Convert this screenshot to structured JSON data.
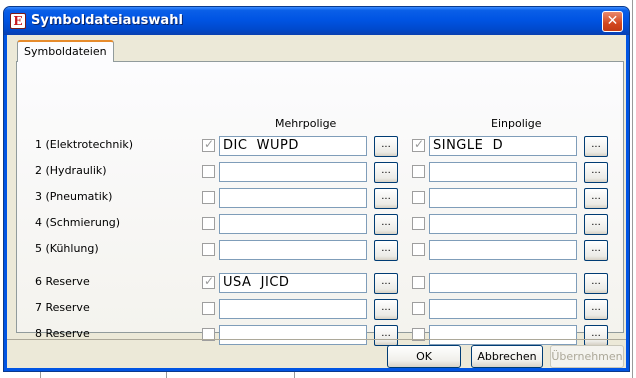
{
  "window": {
    "title": "Symboldateiauswahl",
    "close_glyph": "✕"
  },
  "tab": {
    "label": "Symboldateien"
  },
  "columns": {
    "multi": "Mehrpolige",
    "single": "Einpolige"
  },
  "rows": [
    {
      "label": "1 (Elektrotechnik)",
      "multi_checked": true,
      "multi_value": "DIC  WUPD",
      "single_checked": true,
      "single_value": "SINGLE  D"
    },
    {
      "label": "2 (Hydraulik)",
      "multi_checked": false,
      "multi_value": "",
      "single_checked": false,
      "single_value": ""
    },
    {
      "label": "3 (Pneumatik)",
      "multi_checked": false,
      "multi_value": "",
      "single_checked": false,
      "single_value": ""
    },
    {
      "label": "4 (Schmierung)",
      "multi_checked": false,
      "multi_value": "",
      "single_checked": false,
      "single_value": ""
    },
    {
      "label": "5 (Kühlung)",
      "multi_checked": false,
      "multi_value": "",
      "single_checked": false,
      "single_value": ""
    },
    {
      "label": "6 Reserve",
      "multi_checked": true,
      "multi_value": "USA  JICD",
      "single_checked": false,
      "single_value": ""
    },
    {
      "label": "7 Reserve",
      "multi_checked": false,
      "multi_value": "",
      "single_checked": false,
      "single_value": ""
    },
    {
      "label": "8 Reserve",
      "multi_checked": false,
      "multi_value": "",
      "single_checked": false,
      "single_value": ""
    }
  ],
  "browse_label": "...",
  "buttons": {
    "ok": "OK",
    "cancel": "Abbrechen",
    "apply": "Übernehmen"
  },
  "colors": {
    "titlebar": "#0054e3",
    "dialog_bg": "#ece9d8",
    "tab_accent": "#e68b2c"
  },
  "icons": {
    "app": "eplan-app-icon",
    "close": "close-icon"
  }
}
